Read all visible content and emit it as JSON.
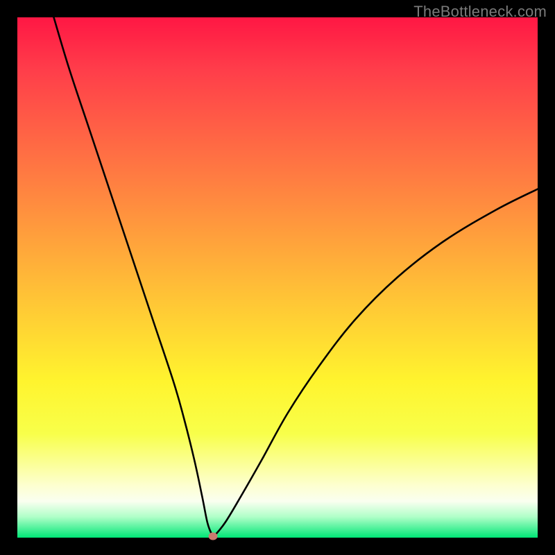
{
  "watermark": "TheBottleneck.com",
  "chart_data": {
    "type": "line",
    "title": "",
    "xlabel": "",
    "ylabel": "",
    "xlim": [
      0,
      100
    ],
    "ylim": [
      0,
      100
    ],
    "series": [
      {
        "name": "curve",
        "x": [
          7,
          10,
          14,
          18,
          22,
          26,
          30,
          32,
          34,
          35.5,
          36.5,
          37.2,
          37.6,
          38,
          40,
          43,
          47,
          52,
          58,
          65,
          73,
          82,
          92,
          100
        ],
        "y": [
          100,
          90,
          78,
          66,
          54,
          42,
          30,
          23,
          15,
          8,
          3,
          1,
          0.3,
          0.5,
          3,
          8,
          15,
          24,
          33,
          42,
          50,
          57,
          63,
          67
        ]
      }
    ],
    "marker": {
      "x": 37.6,
      "y": 0.3,
      "color": "#c97b6f"
    },
    "gradient_stops": [
      {
        "pos": 0,
        "color": "#ff1744"
      },
      {
        "pos": 50,
        "color": "#ffb838"
      },
      {
        "pos": 80,
        "color": "#f8ff4a"
      },
      {
        "pos": 100,
        "color": "#00e676"
      }
    ]
  }
}
